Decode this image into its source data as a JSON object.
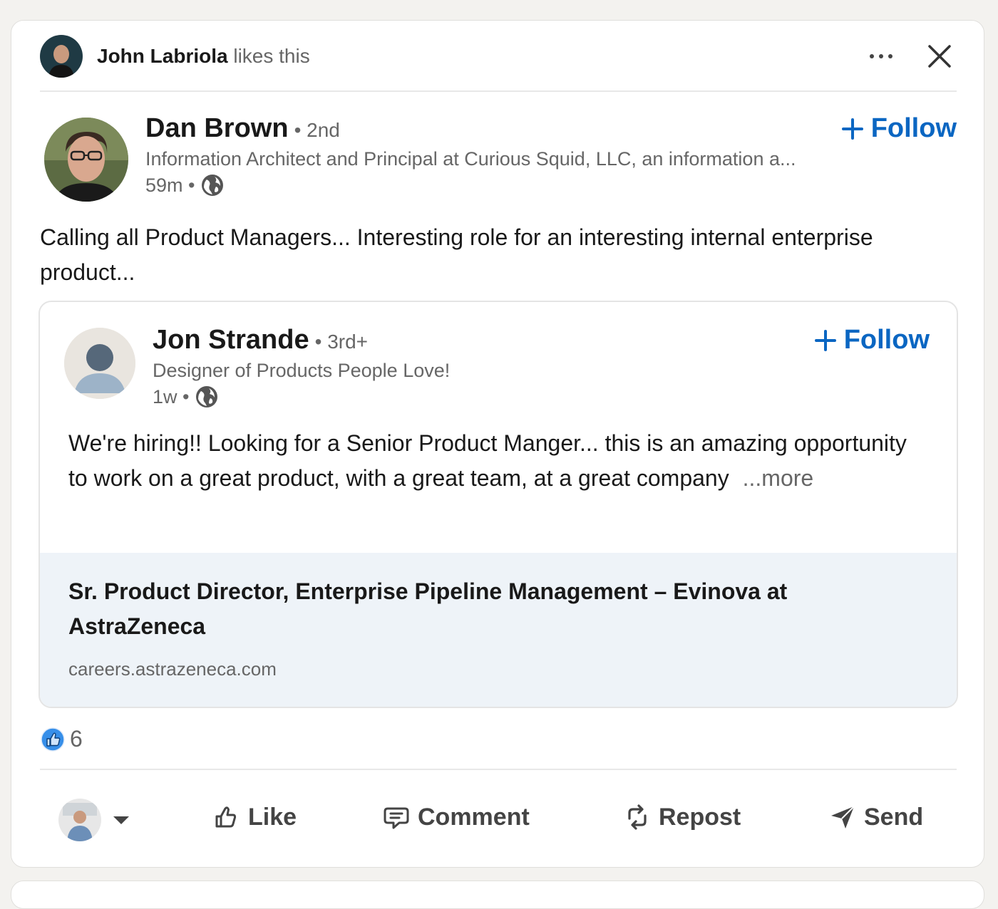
{
  "social_context": {
    "actor_name": "John Labriola",
    "action_text": "likes this"
  },
  "post": {
    "author": {
      "name": "Dan Brown",
      "degree": "• 2nd",
      "headline": "Information Architect and Principal at Curious Squid, LLC, an information a...",
      "time": "59m •",
      "follow_label": "Follow"
    },
    "commentary": "Calling all Product Managers... Interesting role for an interesting internal enterprise product...",
    "shared": {
      "author": {
        "name": "Jon Strande",
        "degree": "• 3rd+",
        "headline": "Designer of Products People Love!",
        "time": "1w •",
        "follow_label": "Follow"
      },
      "text": "We're hiring!! Looking for a Senior Product Manger... this is an amazing opportunity to work on a great product, with a great team, at a great company",
      "more_label": "...more",
      "link": {
        "title": "Sr. Product Director, Enterprise Pipeline Management – Evinova at AstraZeneca",
        "domain": "careers.astrazeneca.com"
      }
    },
    "reactions": {
      "count": "6",
      "icon": "like-reaction-icon"
    }
  },
  "actions": {
    "like": "Like",
    "comment": "Comment",
    "repost": "Repost",
    "send": "Send"
  },
  "colors": {
    "brand_blue": "#0a66c2",
    "preview_bg": "#eef3f8",
    "muted_text": "#666666"
  }
}
